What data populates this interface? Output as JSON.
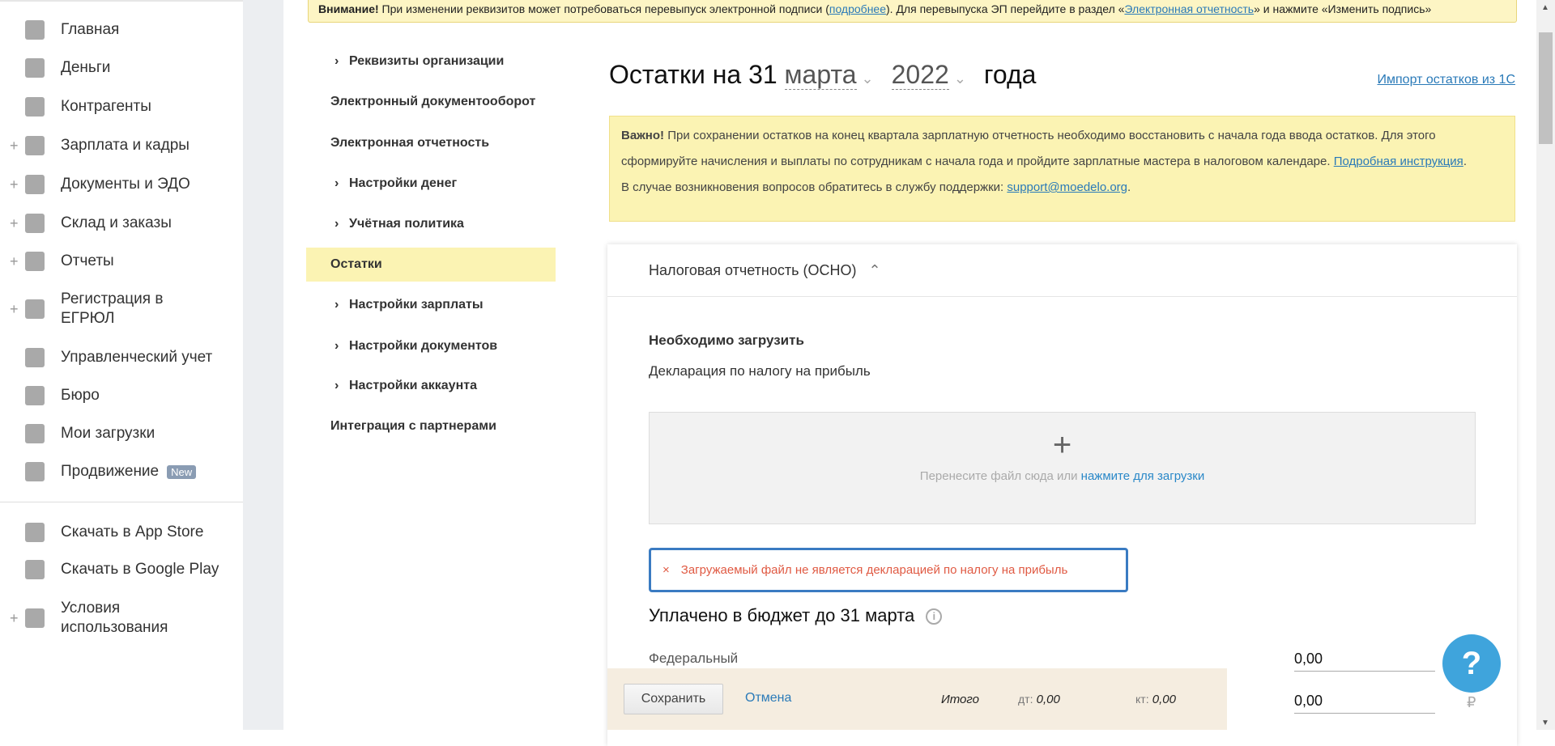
{
  "sidebar": {
    "items": [
      {
        "label": "Главная",
        "icon": "home-icon",
        "plus": false
      },
      {
        "label": "Деньги",
        "icon": "money-icon",
        "plus": false
      },
      {
        "label": "Контрагенты",
        "icon": "contractors-icon",
        "plus": false
      },
      {
        "label": "Зарплата и кадры",
        "icon": "wallet-icon",
        "plus": true
      },
      {
        "label": "Документы и ЭДО",
        "icon": "folder-icon",
        "plus": true
      },
      {
        "label": "Склад и заказы",
        "icon": "warehouse-icon",
        "plus": true
      },
      {
        "label": "Отчеты",
        "icon": "reports-icon",
        "plus": true
      },
      {
        "label": "Регистрация в ЕГРЮЛ",
        "icon": "registration-icon",
        "plus": true
      },
      {
        "label": "Управленческий учет",
        "icon": "management-icon",
        "plus": false
      },
      {
        "label": "Бюро",
        "icon": "briefcase-icon",
        "plus": false
      },
      {
        "label": "Мои загрузки",
        "icon": "folder-icon",
        "plus": false
      },
      {
        "label": "Продвижение",
        "icon": "chart-icon",
        "plus": false,
        "badge": "New"
      },
      {
        "label": "Скачать в App Store",
        "icon": "apple-icon",
        "plus": false
      },
      {
        "label": "Скачать в Google Play",
        "icon": "google-play-icon",
        "plus": false
      },
      {
        "label": "Условия использования",
        "icon": "more-icon",
        "plus": true
      }
    ],
    "plus_symbol": "+"
  },
  "banner": {
    "bold": "Внимание!",
    "text1": " При изменении реквизитов может потребоваться перевыпуск электронной подписи (",
    "link1": "подробнее",
    "text2": "). Для перевыпуска ЭП перейдите в раздел «",
    "link2": "Электронная отчетность",
    "text3": "» и нажмите «Изменить подпись»"
  },
  "settings_nav": [
    {
      "label": "Реквизиты организации",
      "chevron": true
    },
    {
      "label": "Электронный документооборот",
      "chevron": false
    },
    {
      "label": "Электронная отчетность",
      "chevron": false
    },
    {
      "label": "Настройки денег",
      "chevron": true
    },
    {
      "label": "Учётная политика",
      "chevron": true
    },
    {
      "label": "Остатки",
      "chevron": false,
      "active": true
    },
    {
      "label": "Настройки зарплаты",
      "chevron": true
    },
    {
      "label": "Настройки документов",
      "chevron": true
    },
    {
      "label": "Настройки аккаунта",
      "chevron": true
    },
    {
      "label": "Интеграция с партнерами",
      "chevron": false
    }
  ],
  "chevron": "›",
  "title": {
    "prefix": "Остатки на 31 ",
    "month": "марта",
    "year": "2022",
    "suffix": "года",
    "caret": "⌄"
  },
  "import_link": "Импорт остатков из 1С",
  "important": {
    "bold": "Важно!",
    "text": " При сохранении остатков на конец квартала зарплатную отчетность необходимо восстановить с начала года ввода остатков. Для этого сформируйте начисления и выплаты по сотрудникам с начала года и пройдите зарплатные мастера в налоговом календаре. ",
    "link": "Подробная инструкция",
    "dot": ".",
    "support_text": "В случае возникновения вопросов обратитесь в службу поддержки: ",
    "support_link": "support@moedelo.org"
  },
  "card": {
    "header": "Налоговая отчетность (ОСНО)",
    "header_caret": "⌃",
    "need_title": "Необходимо загрузить",
    "declaration": "Декларация по налогу на прибыль",
    "drop": {
      "plus": "+",
      "text": "Перенесите файл сюда или ",
      "link": "нажмите для загрузки"
    },
    "error": {
      "icon": "×",
      "text": "Загружаемый файл не является декларацией по налогу на прибыль"
    },
    "paid_title": "Уплачено в бюджет до 31 марта",
    "info": "i",
    "federal": "Федеральный",
    "fed_value": "0,00",
    "second_value": "0,00",
    "currency": "₽"
  },
  "bottom": {
    "save": "Сохранить",
    "cancel": "Отмена",
    "total": "Итого",
    "dt_label": "дт:",
    "dt_value": "0,00",
    "kt_label": "кт:",
    "kt_value": "0,00"
  },
  "help": "?",
  "scroll": {
    "up": "▲",
    "down": "▼"
  }
}
